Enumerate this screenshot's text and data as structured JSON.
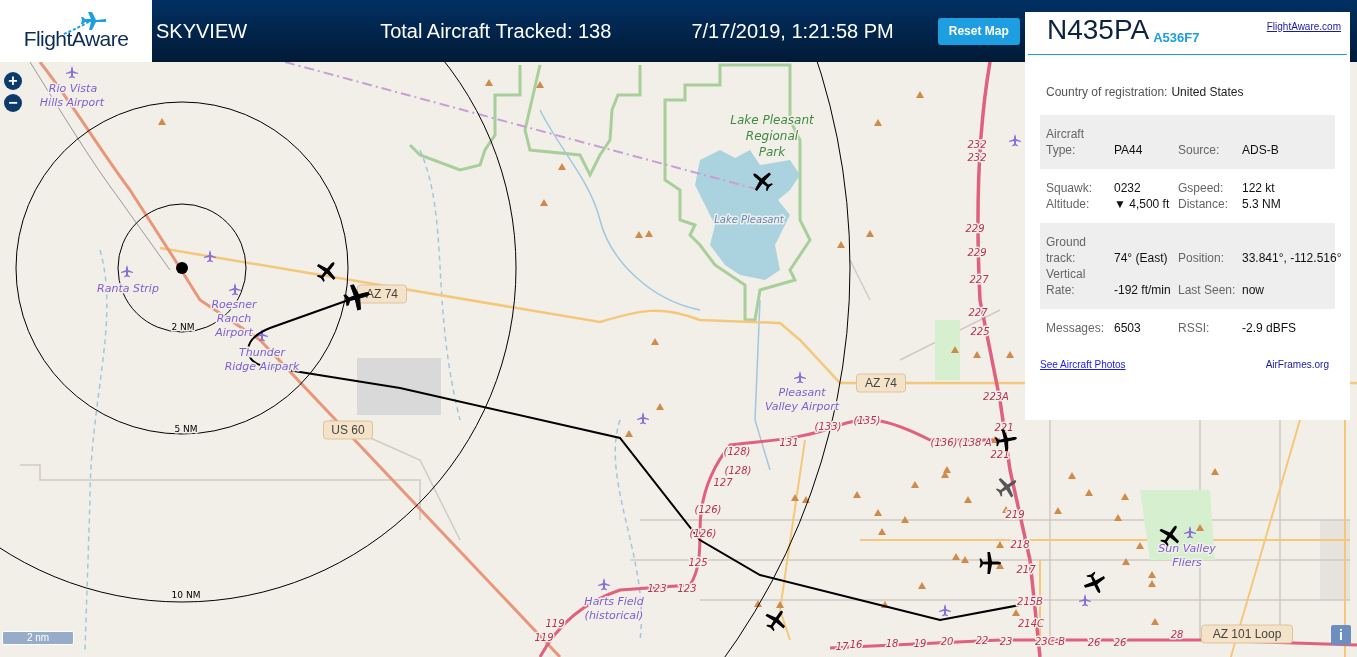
{
  "header": {
    "logo": "FlightAware",
    "title": "SKYVIEW",
    "total_tracked": "Total Aircraft Tracked: 138",
    "datetime": "7/17/2019, 1:21:58 PM",
    "reset_button": "Reset Map"
  },
  "map": {
    "zoom_in": "+",
    "zoom_out": "−",
    "scale": "2 nm",
    "info_button": "i",
    "labels": [
      {
        "kind": "airport",
        "text": "Rio Vista"
      },
      {
        "kind": "airport",
        "text": "Hills Airport"
      },
      {
        "kind": "park",
        "text": "Lake Pleasant"
      },
      {
        "kind": "park",
        "text": "Regional"
      },
      {
        "kind": "park",
        "text": "Park"
      },
      {
        "kind": "exit",
        "text": "232"
      },
      {
        "kind": "exit",
        "text": "232"
      },
      {
        "kind": "water",
        "text": "Lake Pleasant"
      },
      {
        "kind": "exit",
        "text": "229"
      },
      {
        "kind": "exit",
        "text": "229"
      },
      {
        "kind": "exit",
        "text": "227"
      },
      {
        "kind": "airport",
        "text": "Ranta Strip"
      },
      {
        "kind": "shield",
        "text": "AZ 74"
      },
      {
        "kind": "airport",
        "text": "Roesner"
      },
      {
        "kind": "airport",
        "text": "Ranch"
      },
      {
        "kind": "airport",
        "text": "Airport"
      },
      {
        "kind": "exit",
        "text": "227"
      },
      {
        "kind": "ring",
        "text": "2 NM"
      },
      {
        "kind": "exit",
        "text": "225"
      },
      {
        "kind": "airport",
        "text": "Thunder"
      },
      {
        "kind": "airport",
        "text": "Ridge Airpark"
      },
      {
        "kind": "shield",
        "text": "AZ 74"
      },
      {
        "kind": "airport",
        "text": "Pleasant"
      },
      {
        "kind": "airport",
        "text": "Valley Airport"
      },
      {
        "kind": "exit",
        "text": "223A"
      },
      {
        "kind": "ring",
        "text": "5 NM"
      },
      {
        "kind": "shield",
        "text": "US 60"
      },
      {
        "kind": "exit",
        "text": "(133)"
      },
      {
        "kind": "exit",
        "text": "(135)"
      },
      {
        "kind": "exit",
        "text": "221"
      },
      {
        "kind": "exit",
        "text": "(128)"
      },
      {
        "kind": "exit",
        "text": "131"
      },
      {
        "kind": "exit",
        "text": "(136)"
      },
      {
        "kind": "exit",
        "text": "(138 A"
      },
      {
        "kind": "exit",
        "text": "221"
      },
      {
        "kind": "exit",
        "text": "(128)"
      },
      {
        "kind": "exit",
        "text": "127"
      },
      {
        "kind": "exit",
        "text": "(126)"
      },
      {
        "kind": "exit",
        "text": "219"
      },
      {
        "kind": "exit",
        "text": "(126)"
      },
      {
        "kind": "exit",
        "text": "218"
      },
      {
        "kind": "airport",
        "text": "Sun Valley"
      },
      {
        "kind": "exit",
        "text": "125"
      },
      {
        "kind": "exit",
        "text": "217"
      },
      {
        "kind": "airport",
        "text": "Fliers"
      },
      {
        "kind": "ring",
        "text": "10 NM"
      },
      {
        "kind": "exit",
        "text": "123"
      },
      {
        "kind": "exit",
        "text": "123"
      },
      {
        "kind": "airport",
        "text": "Harts Field"
      },
      {
        "kind": "exit",
        "text": "215B"
      },
      {
        "kind": "exit",
        "text": "119"
      },
      {
        "kind": "airport",
        "text": "(historical)"
      },
      {
        "kind": "exit",
        "text": "214C"
      },
      {
        "kind": "exit",
        "text": "119"
      },
      {
        "kind": "exit",
        "text": "17"
      },
      {
        "kind": "exit",
        "text": "16"
      },
      {
        "kind": "exit",
        "text": "18"
      },
      {
        "kind": "exit",
        "text": "19"
      },
      {
        "kind": "exit",
        "text": "20"
      },
      {
        "kind": "exit",
        "text": "22"
      },
      {
        "kind": "exit",
        "text": "23"
      },
      {
        "kind": "exit",
        "text": "23C-B"
      },
      {
        "kind": "exit",
        "text": "26"
      },
      {
        "kind": "exit",
        "text": "26"
      },
      {
        "kind": "exit",
        "text": "28"
      },
      {
        "kind": "shield",
        "text": "AZ 101 Loop"
      }
    ],
    "aircraft": [
      {
        "color": "#000000",
        "selected": false
      },
      {
        "color": "#000000",
        "selected": true
      },
      {
        "color": "#000000",
        "selected": false
      },
      {
        "color": "#000000",
        "selected": false
      },
      {
        "color": "#555555",
        "selected": false
      },
      {
        "color": "#000000",
        "selected": false
      },
      {
        "color": "#000000",
        "selected": false
      },
      {
        "color": "#000000",
        "selected": false
      },
      {
        "color": "#000000",
        "selected": false
      }
    ]
  },
  "panel": {
    "registration": "N435PA",
    "hex": "A536F7",
    "link": "FlightAware.com",
    "country_label": "Country of registration:",
    "country": "United States",
    "groups": [
      {
        "rows": [
          [
            {
              "label": "Aircraft Type:",
              "value": "PA44"
            },
            {
              "label": "Source:",
              "value": "ADS-B"
            }
          ]
        ]
      },
      {
        "rows": [
          [
            {
              "label": "Squawk:",
              "value": "0232"
            },
            {
              "label": "Gspeed:",
              "value": "122 kt"
            }
          ],
          [
            {
              "label": "Altitude:",
              "value": "▼ 4,500 ft"
            },
            {
              "label": "Distance:",
              "value": "5.3 NM"
            }
          ]
        ]
      },
      {
        "rows": [
          [
            {
              "label": "Ground track:",
              "value": "74° (East)"
            },
            {
              "label": "Position:",
              "value": "33.841°, -112.516°"
            }
          ],
          [
            {
              "label": "Vertical Rate:",
              "value": "-192 ft/min"
            },
            {
              "label": "Last Seen:",
              "value": "now"
            }
          ]
        ]
      },
      {
        "rows": [
          [
            {
              "label": "Messages:",
              "value": "6503"
            },
            {
              "label": "RSSI:",
              "value": "-2.9 dBFS"
            }
          ]
        ]
      }
    ],
    "photos_link": "See Aircraft Photos",
    "airframes_link": "AirFrames.org"
  }
}
